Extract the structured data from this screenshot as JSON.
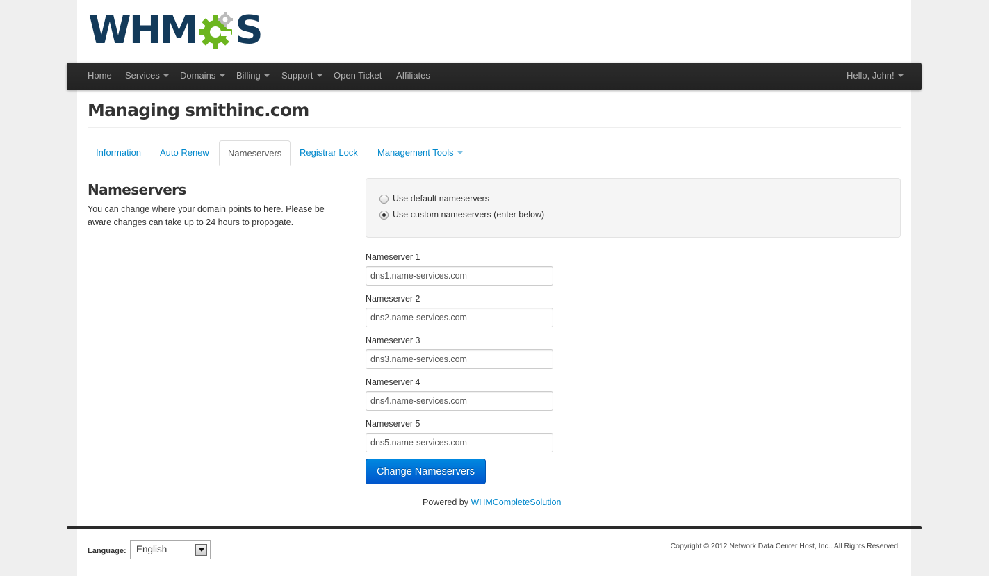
{
  "brand": {
    "logo_text_left": "WHM",
    "logo_text_right": "S",
    "logo_gear_color": "#6cb51e",
    "logo_text_color": "#133a5a"
  },
  "nav": {
    "items": [
      {
        "label": "Home",
        "dropdown": false
      },
      {
        "label": "Services",
        "dropdown": true
      },
      {
        "label": "Domains",
        "dropdown": true
      },
      {
        "label": "Billing",
        "dropdown": true
      },
      {
        "label": "Support",
        "dropdown": true
      },
      {
        "label": "Open Ticket",
        "dropdown": false
      },
      {
        "label": "Affiliates",
        "dropdown": false
      }
    ],
    "user_menu": "Hello, John!"
  },
  "page": {
    "title": "Managing smithinc.com"
  },
  "tabs": [
    {
      "label": "Information",
      "active": false
    },
    {
      "label": "Auto Renew",
      "active": false
    },
    {
      "label": "Nameservers",
      "active": true
    },
    {
      "label": "Registrar Lock",
      "active": false
    },
    {
      "label": "Management Tools",
      "active": false,
      "dropdown": true
    }
  ],
  "section": {
    "title": "Nameservers",
    "description": "You can change where your domain points to here. Please be aware changes can take up to 24 hours to propogate."
  },
  "options": {
    "default_label": "Use default nameservers",
    "custom_label": "Use custom nameservers (enter below)",
    "selected": "custom"
  },
  "nameservers": [
    {
      "label": "Nameserver 1",
      "value": "dns1.name-services.com"
    },
    {
      "label": "Nameserver 2",
      "value": "dns2.name-services.com"
    },
    {
      "label": "Nameserver 3",
      "value": "dns3.name-services.com"
    },
    {
      "label": "Nameserver 4",
      "value": "dns4.name-services.com"
    },
    {
      "label": "Nameserver 5",
      "value": "dns5.name-services.com"
    }
  ],
  "submit_label": "Change Nameservers",
  "powered": {
    "prefix": "Powered by",
    "link": "WHMCompleteSolution"
  },
  "footer": {
    "language_label": "Language:",
    "language_value": "English",
    "copyright": "Copyright © 2012 Network Data Center Host, Inc.. All Rights Reserved."
  }
}
